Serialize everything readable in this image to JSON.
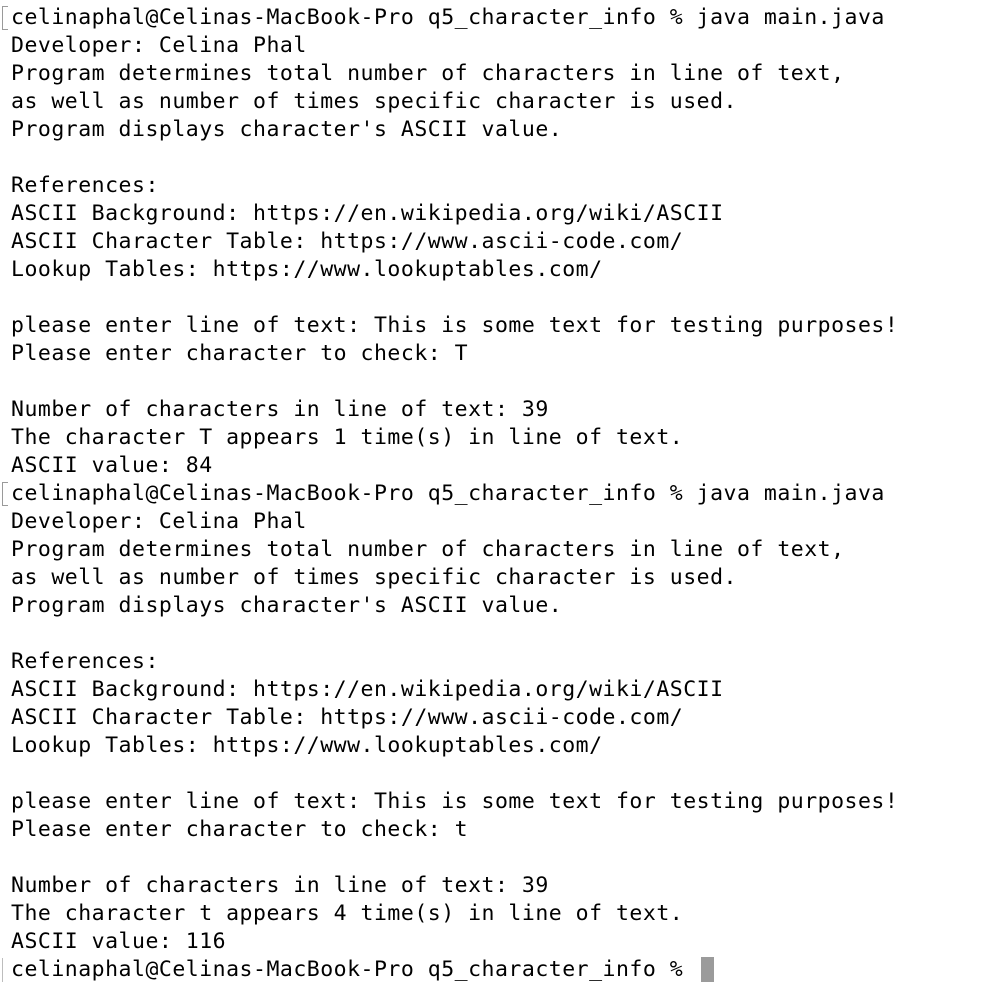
{
  "terminal": {
    "run1": {
      "prompt": "celinaphal@Celinas-MacBook-Pro q5_character_info % java main.java",
      "developer": "Developer: Celina Phal",
      "desc1": "Program determines total number of characters in line of text,",
      "desc2": "as well as number of times specific character is used.",
      "desc3": "Program displays character's ASCII value.",
      "refs_heading": "References:",
      "ref1": "ASCII Background: https://en.wikipedia.org/wiki/ASCII",
      "ref2": "ASCII Character Table: https://www.ascii-code.com/",
      "ref3": "Lookup Tables: https://www.lookuptables.com/",
      "input_line": "please enter line of text: This is some text for testing purposes!",
      "input_char": "Please enter character to check: T",
      "count_line": "Number of characters in line of text: 39",
      "appears_line": "The character T appears 1 time(s) in line of text.",
      "ascii_line": "ASCII value: 84"
    },
    "run2": {
      "prompt": "celinaphal@Celinas-MacBook-Pro q5_character_info % java main.java",
      "developer": "Developer: Celina Phal",
      "desc1": "Program determines total number of characters in line of text,",
      "desc2": "as well as number of times specific character is used.",
      "desc3": "Program displays character's ASCII value.",
      "refs_heading": "References:",
      "ref1": "ASCII Background: https://en.wikipedia.org/wiki/ASCII",
      "ref2": "ASCII Character Table: https://www.ascii-code.com/",
      "ref3": "Lookup Tables: https://www.lookuptables.com/",
      "input_line": "please enter line of text: This is some text for testing purposes!",
      "input_char": "Please enter character to check: t",
      "count_line": "Number of characters in line of text: 39",
      "appears_line": "The character t appears 4 time(s) in line of text.",
      "ascii_line": "ASCII value: 116"
    },
    "final_prompt": "celinaphal@Celinas-MacBook-Pro q5_character_info % ",
    "colors": {
      "background": "#ffffff",
      "text": "#000000",
      "cursor": "#9b9b9b",
      "mark": "#9a9a9a"
    }
  }
}
